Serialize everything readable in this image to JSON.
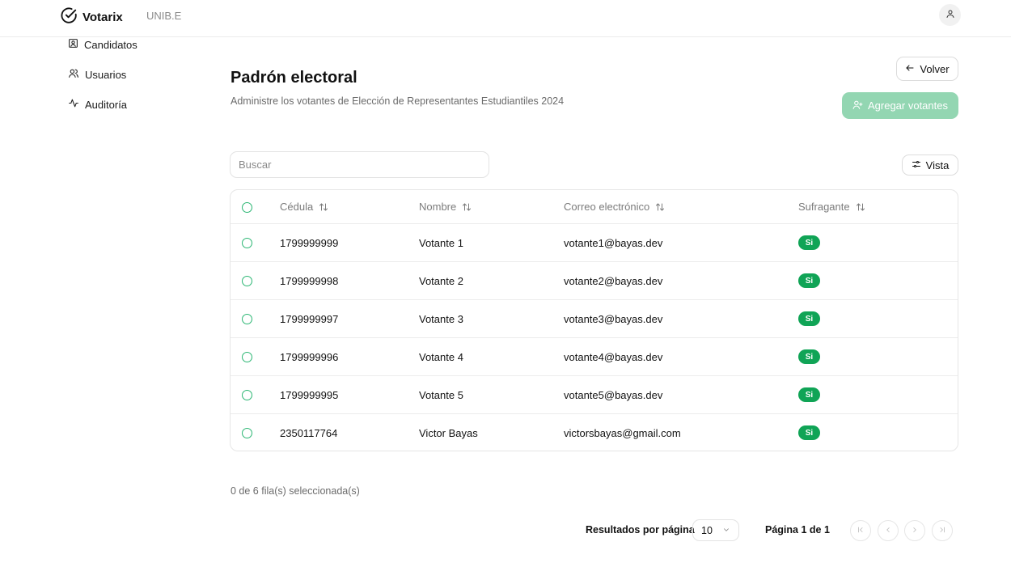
{
  "header": {
    "brand": "Votarix",
    "org": "UNIB.E"
  },
  "sidebar": {
    "items": [
      {
        "label": "Candidatos",
        "icon": "id-card-icon"
      },
      {
        "label": "Usuarios",
        "icon": "users-icon"
      },
      {
        "label": "Auditoría",
        "icon": "activity-icon"
      }
    ]
  },
  "main": {
    "title": "Padrón electoral",
    "subtitle": "Administre los votantes de Elección de Representantes Estudiantiles 2024",
    "back_label": "Volver",
    "add_label": "Agregar votantes",
    "search_placeholder": "Buscar",
    "view_label": "Vista"
  },
  "table": {
    "columns": [
      "Cédula",
      "Nombre",
      "Correo electrónico",
      "Sufragante"
    ],
    "rows": [
      {
        "cedula": "1799999999",
        "nombre": "Votante 1",
        "correo": "votante1@bayas.dev",
        "sufragante": "Si"
      },
      {
        "cedula": "1799999998",
        "nombre": "Votante 2",
        "correo": "votante2@bayas.dev",
        "sufragante": "Si"
      },
      {
        "cedula": "1799999997",
        "nombre": "Votante 3",
        "correo": "votante3@bayas.dev",
        "sufragante": "Si"
      },
      {
        "cedula": "1799999996",
        "nombre": "Votante 4",
        "correo": "votante4@bayas.dev",
        "sufragante": "Si"
      },
      {
        "cedula": "1799999995",
        "nombre": "Votante 5",
        "correo": "votante5@bayas.dev",
        "sufragante": "Si"
      },
      {
        "cedula": "2350117764",
        "nombre": "Victor Bayas",
        "correo": "victorsbayas@gmail.com",
        "sufragante": "Si"
      }
    ]
  },
  "footer": {
    "selected_text": "0 de 6 fila(s) seleccionada(s)",
    "per_page_label": "Resultados por página",
    "per_page_value": "10",
    "page_info": "Página 1 de 1"
  },
  "colors": {
    "accent": "#10a456",
    "accent_light": "#93d6b2",
    "checkbox": "#2bb673"
  }
}
